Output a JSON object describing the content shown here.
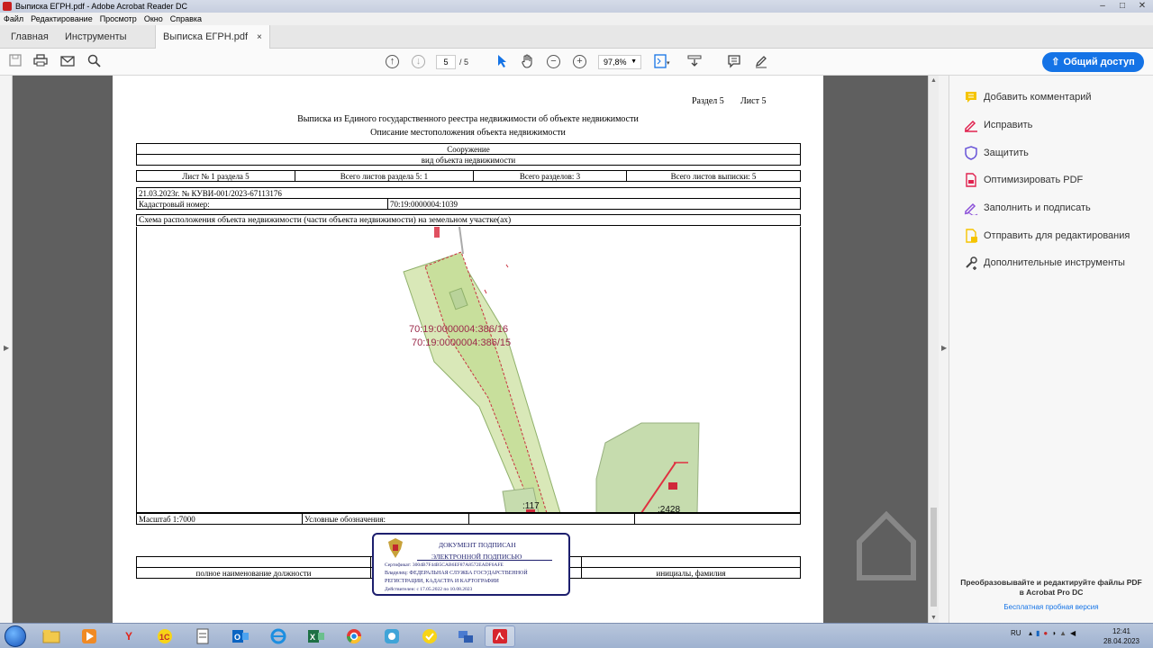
{
  "window": {
    "title": "Выписка ЕГРН.pdf - Adobe Acrobat Reader DC"
  },
  "menu": [
    "Файл",
    "Редактирование",
    "Просмотр",
    "Окно",
    "Справка"
  ],
  "tabs": {
    "home": "Главная",
    "tools": "Инструменты",
    "doc": "Выписка ЕГРН.pdf",
    "close": "×"
  },
  "toolbar": {
    "page_current": "5",
    "page_total": "/ 5",
    "zoom": "97,8%",
    "share": "Общий доступ"
  },
  "right_panel": {
    "tools": [
      {
        "label": "Добавить комментарий",
        "icon": "comment-icon",
        "color": "#f5c400"
      },
      {
        "label": "Исправить",
        "icon": "edit-icon",
        "color": "#e0224f"
      },
      {
        "label": "Защитить",
        "icon": "shield-icon",
        "color": "#6a56d8"
      },
      {
        "label": "Оптимизировать PDF",
        "icon": "optimize-icon",
        "color": "#e0224f"
      },
      {
        "label": "Заполнить и подписать",
        "icon": "sign-icon",
        "color": "#8a4fd8"
      },
      {
        "label": "Отправить для редактирования",
        "icon": "send-icon",
        "color": "#f5c400"
      },
      {
        "label": "Дополнительные инструменты",
        "icon": "more-tools-icon",
        "color": "#444444"
      }
    ],
    "promo_line1": "Преобразовывайте и редактируйте файлы PDF",
    "promo_line2": "в Acrobat Pro DC",
    "trial": "Бесплатная пробная версия"
  },
  "document": {
    "section": "Раздел 5",
    "sheet": "Лист 5",
    "title": "Выписка из Единого государственного реестра недвижимости об объекте недвижимости",
    "subtitle": "Описание местоположения объекта недвижимости",
    "object_type": "Сооружение",
    "object_type_caption": "вид объекта недвижимости",
    "sheet_info": [
      "Лист № 1 раздела 5",
      "Всего листов раздела 5: 1",
      "Всего разделов: 3",
      "Всего листов выписки: 5"
    ],
    "date_number": "21.03.2023г. № КУВИ-001/2023-67113176",
    "cadastral_label": "Кадастровый номер:",
    "cadastral_value": "70:19:0000004:1039",
    "scheme_title": "Схема расположения объекта недвижимости (части объекта недвижимости) на земельном участке(ах)",
    "map_labels": [
      "70:19:0000004:386/16",
      "70:19:0000004:386/15",
      ":117",
      ":2428"
    ],
    "scale": "Масштаб 1:7000",
    "legend": "Условные обозначения:",
    "position_caption": "полное наименование должности",
    "initials_caption": "инициалы, фамилия",
    "stamp": {
      "title1": "ДОКУМЕНТ ПОДПИСАН",
      "title2": "ЭЛЕКТРОННОЙ ПОДПИСЬЮ",
      "cert": "Сертификат: 3004B7F44B5CAB6EF87A8572EADF6AFE",
      "owner1": "Владелец: ФЕДЕРАЛЬНАЯ СЛУЖБА ГОСУДАРСТВЕННОЙ",
      "owner2": "РЕГИСТРАЦИИ, КАДАСТРА И КАРТОГРАФИИ",
      "valid": "Действителен: с 17.05.2022 по 10.08.2023"
    }
  },
  "taskbar": {
    "lang": "RU",
    "time": "12:41",
    "date": "28.04.2023"
  }
}
